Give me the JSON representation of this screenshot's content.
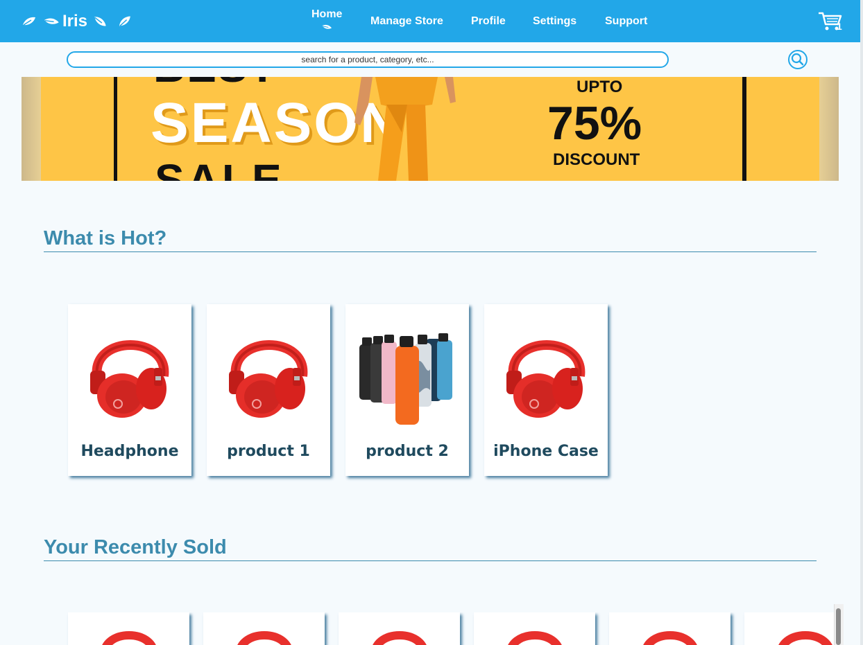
{
  "header": {
    "brand": "Iris",
    "nav": [
      "Home",
      "Manage Store",
      "Profile",
      "Settings",
      "Support"
    ],
    "cart_count": "1",
    "cart_icon": "cart-icon",
    "leaf_icon": "leaf-icon"
  },
  "search": {
    "placeholder": "search for a product, category, etc...",
    "button_icon": "search-icon"
  },
  "banner": {
    "line1": "BEST",
    "line2": "SEASON",
    "line3": "SALE",
    "upto": "UPTO",
    "percent": "75%",
    "discount": "DISCOUNT"
  },
  "sections": {
    "hot_title": "What is Hot?",
    "sold_title": "Your Recently Sold"
  },
  "hot_products": [
    {
      "name": "Headphone",
      "image": "red-headphones"
    },
    {
      "name": "product 1",
      "image": "red-headphones"
    },
    {
      "name": "product 2",
      "image": "water-bottles"
    },
    {
      "name": "iPhone Case",
      "image": "red-headphones"
    }
  ],
  "colors": {
    "primary": "#22a7e8",
    "heading": "#3c8bad",
    "card_text": "#1f4a5e",
    "banner_yellow": "#fec546"
  }
}
